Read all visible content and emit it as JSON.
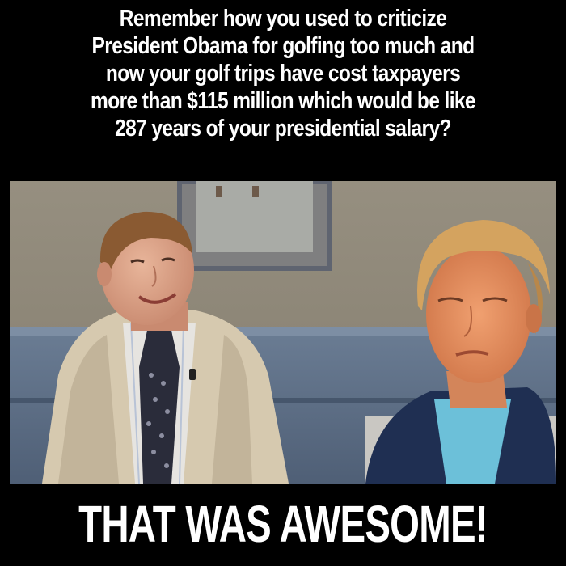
{
  "caption": {
    "lines": [
      "Remember how you used to criticize",
      "President Obama for golfing too much and",
      "now your golf trips have cost taxpayers",
      "more than $115 million which would be like",
      "287 years of your presidential salary?"
    ],
    "punchline": "THAT WAS AWESOME!"
  },
  "photo": {
    "left_person": "man-in-tan-jacket",
    "right_person": "man-in-navy-cardigan",
    "colors": {
      "wall": "#8c8576",
      "wainscot": "#5d6f86",
      "tan_jacket": "#d8cbb2",
      "navy_cardigan": "#1d2f54",
      "light_blue_shirt": "#6ec0d8"
    }
  }
}
